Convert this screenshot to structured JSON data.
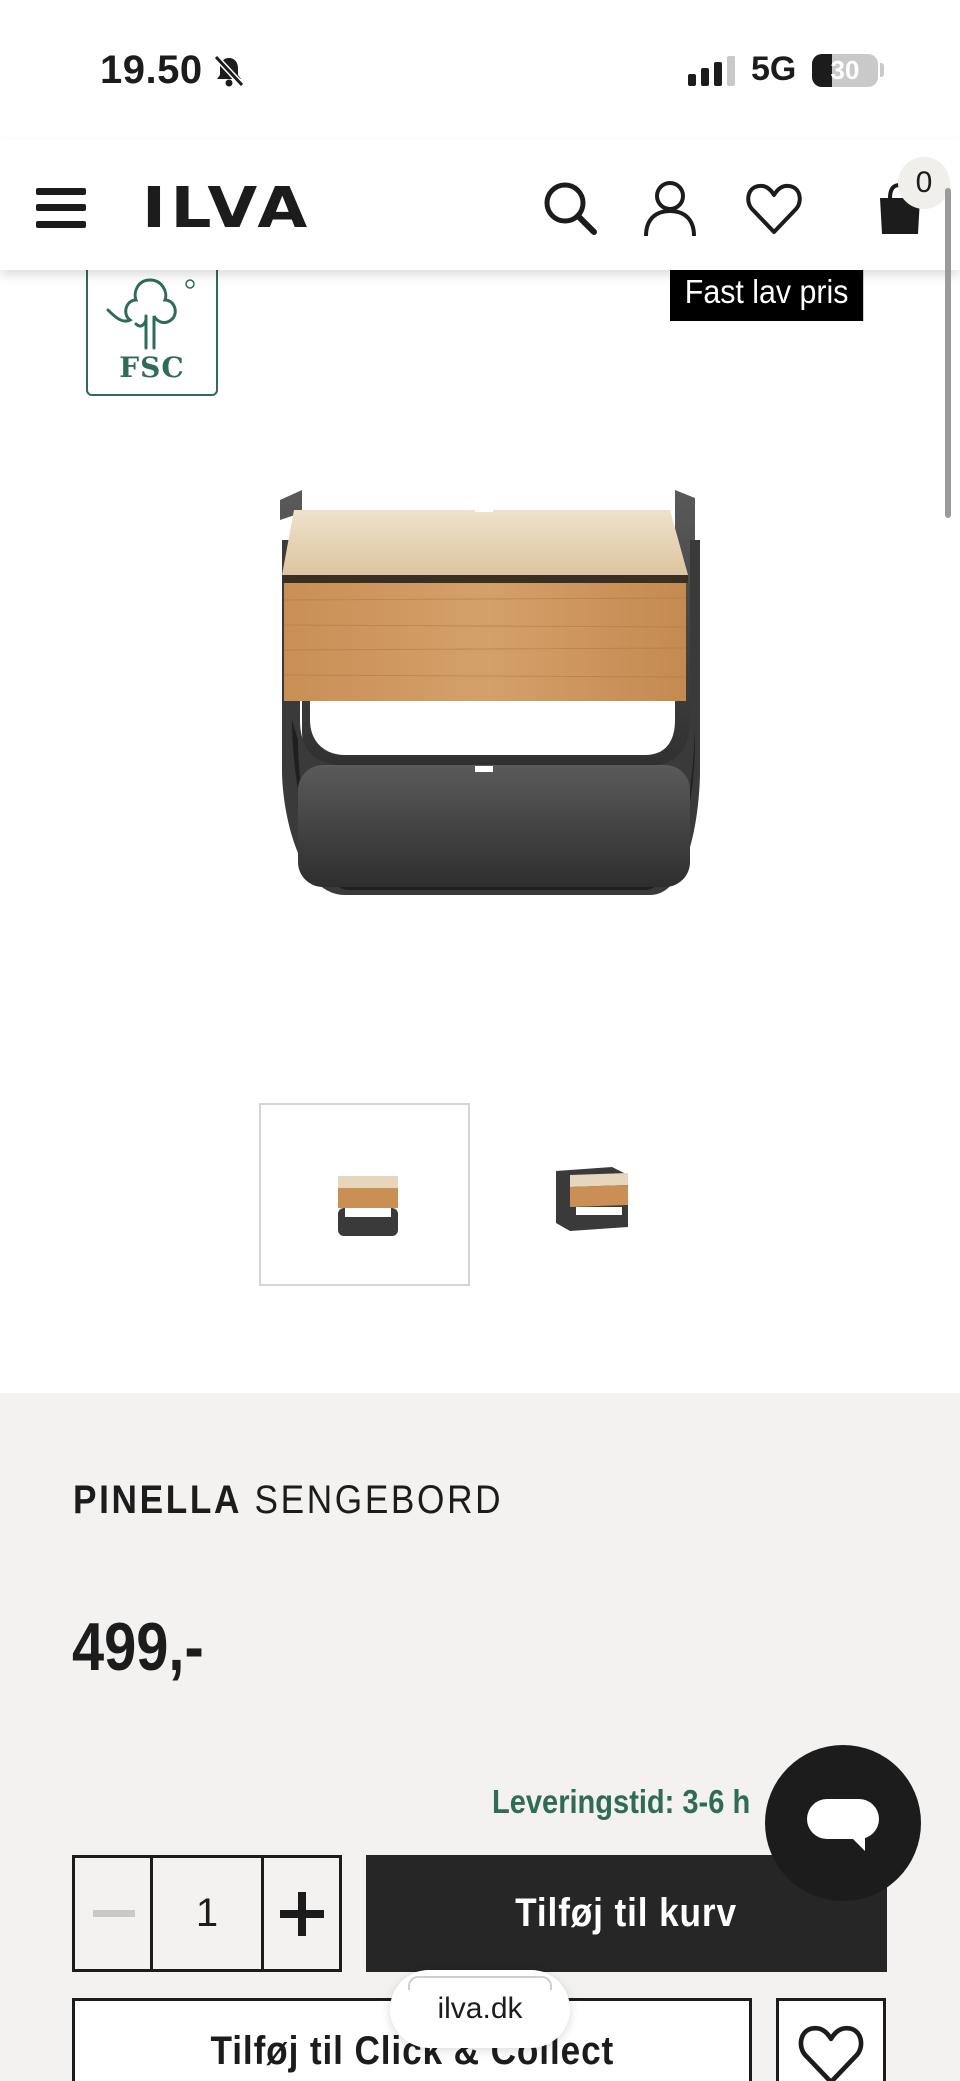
{
  "status_bar": {
    "time": "19.50",
    "network": "5G",
    "battery": "30",
    "battery_level": 0.3
  },
  "header": {
    "logo": "ILVA",
    "cart_count": "0",
    "icons": [
      "menu-icon",
      "search-icon",
      "account-icon",
      "heart-icon",
      "cart-icon"
    ]
  },
  "gallery": {
    "badge": "FSC",
    "price_tag": "Fast lav pris",
    "thumbnail_count": 2,
    "selected_thumbnail": 1
  },
  "product": {
    "brand": "PINELLA",
    "type": "SENGEBORD",
    "price": "499,-",
    "delivery": "Leveringstid: 3-6 h"
  },
  "actions": {
    "quantity": "1",
    "add_to_cart": "Tilføj til kurv",
    "click_collect": "Tilføj til Click & Collect"
  },
  "browser": {
    "url": "ilva.dk"
  },
  "colors": {
    "accent_green": "#2f6b55",
    "dark": "#1c1c1c",
    "info_bg": "#f3f2f0"
  }
}
